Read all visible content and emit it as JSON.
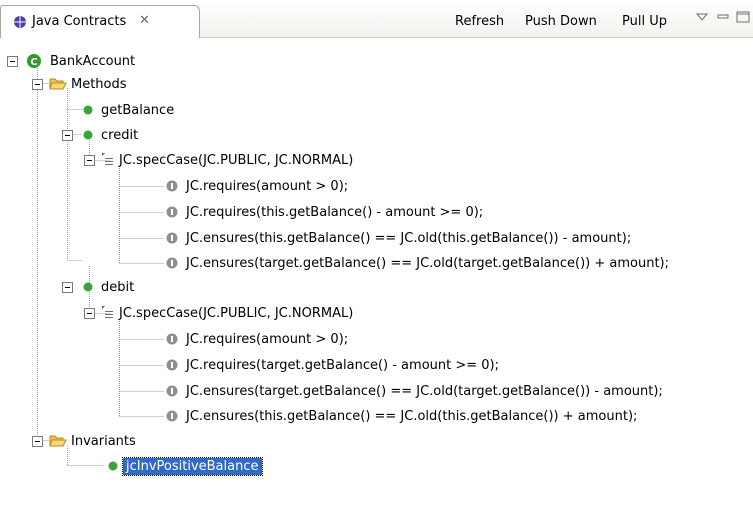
{
  "view": {
    "tab_title": "Java Contracts",
    "tab_close": "✕"
  },
  "toolbar": {
    "refresh_label": "Refresh",
    "push_down_label": "Push Down",
    "pull_up_label": "Pull Up"
  },
  "tree": {
    "root": "BankAccount",
    "methods_folder": "Methods",
    "methods": [
      {
        "name": "getBalance"
      },
      {
        "name": "credit",
        "spec_case": "JC.specCase(JC.PUBLIC, JC.NORMAL)",
        "clauses": [
          "JC.requires(amount > 0);",
          "JC.requires(this.getBalance() - amount >= 0);",
          "JC.ensures(this.getBalance() == JC.old(this.getBalance()) - amount);",
          "JC.ensures(target.getBalance() == JC.old(target.getBalance()) + amount);"
        ]
      },
      {
        "name": "debit",
        "spec_case": "JC.specCase(JC.PUBLIC, JC.NORMAL)",
        "clauses": [
          "JC.requires(amount > 0);",
          "JC.requires(target.getBalance() - amount >= 0);",
          "JC.ensures(target.getBalance() == JC.old(target.getBalance()) - amount);",
          "JC.ensures(this.getBalance() == JC.old(this.getBalance()) + amount);"
        ]
      }
    ],
    "invariants_folder": "Invariants",
    "invariants": [
      "jcInvPositiveBalance"
    ]
  },
  "colors": {
    "selection": "#316ac5",
    "method_dot": "#3aa33a",
    "folder": "#f2c04b",
    "class_icon": "#2f9a2f",
    "clause_icon": "#8f8f8f"
  }
}
